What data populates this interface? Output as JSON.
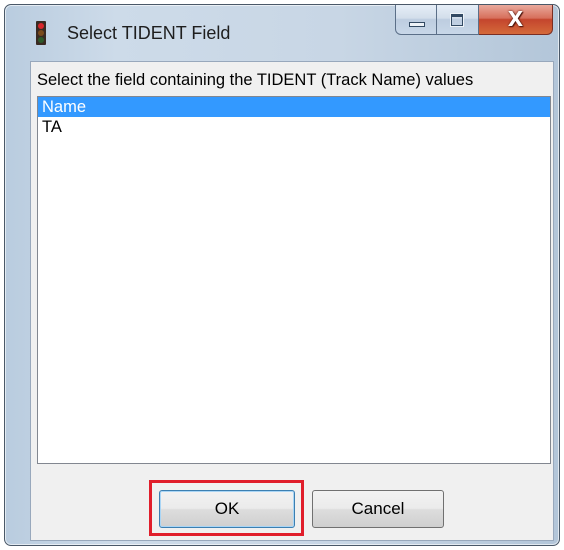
{
  "window": {
    "title": "Select TIDENT Field",
    "icon": "traffic-light-icon"
  },
  "caption_buttons": {
    "minimize_icon": "minimize-icon",
    "maximize_icon": "maximize-icon",
    "close_glyph": "X"
  },
  "dialog": {
    "prompt": "Select the field containing the TIDENT (Track Name) values",
    "fields": [
      {
        "label": "Name",
        "selected": true
      },
      {
        "label": "TA",
        "selected": false
      }
    ],
    "ok_label": "OK",
    "cancel_label": "Cancel"
  },
  "colors": {
    "selection": "#3399ff",
    "highlight_box": "#e01e2b",
    "close_button": "#c4452d"
  }
}
